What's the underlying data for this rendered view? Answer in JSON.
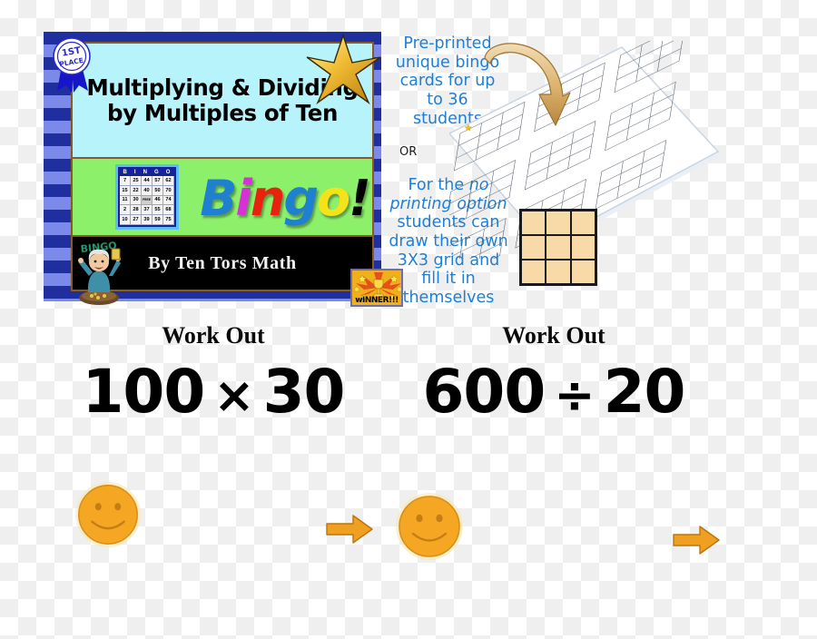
{
  "cover": {
    "title": "Multiplying & Dividing by Multiples of Ten",
    "bingo_word_letters": [
      {
        "char": "B",
        "color": "#1f7fd0"
      },
      {
        "char": "i",
        "color": "#d631d6"
      },
      {
        "char": "n",
        "color": "#e8220e"
      },
      {
        "char": "g",
        "color": "#1f7fd0"
      },
      {
        "char": "o",
        "color": "#f5e317"
      },
      {
        "char": "!",
        "color": "#000000"
      }
    ],
    "bingo_word": "Bingo!",
    "author": "By Ten Tors Math",
    "ribbon_label_line1": "1ST",
    "ribbon_label_line2": "PLACE",
    "winner_badge_label": "wINNER!!!",
    "lady_label": "BINGO",
    "mini_card": {
      "header": [
        "B",
        "I",
        "N",
        "G",
        "O"
      ],
      "rows": [
        [
          "7",
          "25",
          "44",
          "57",
          "62"
        ],
        [
          "15",
          "22",
          "40",
          "50",
          "70"
        ],
        [
          "11",
          "30",
          "FREE",
          "46",
          "74"
        ],
        [
          "2",
          "28",
          "37",
          "55",
          "68"
        ],
        [
          "10",
          "27",
          "39",
          "59",
          "75"
        ]
      ]
    },
    "colors": {
      "border_dark_blue": "#1f2f9e",
      "border_light_blue": "#7b8ae8",
      "title_band": "#b6f3fb",
      "green_band": "#8cf06a",
      "frame_brown": "#8a5a1e"
    }
  },
  "annotations": {
    "preprinted": "Pre-printed unique bingo cards for up to 36 students",
    "or": "OR",
    "noprint_pre": "For the ",
    "noprint_ital": "no printing option",
    "noprint_post": " students can draw their own 3X3 grid and fill it in themselves",
    "noprint_full": "For the no printing option students can draw their own 3X3 grid and fill it in themselves",
    "text_color": "#1e7fd6"
  },
  "questions": [
    {
      "label": "Work Out",
      "operand_a": "100",
      "operator": "×",
      "operand_b": "30",
      "expression": "100 × 30"
    },
    {
      "label": "Work Out",
      "operand_a": "600",
      "operator": "÷",
      "operand_b": "20",
      "expression": "600 ÷ 20"
    }
  ],
  "decorations": {
    "smiley_color": "#f29b22",
    "arrow_color": "#f29b22",
    "grid_rows": 3,
    "grid_cols": 3,
    "grid_cell_color": "#f8d9a8"
  }
}
